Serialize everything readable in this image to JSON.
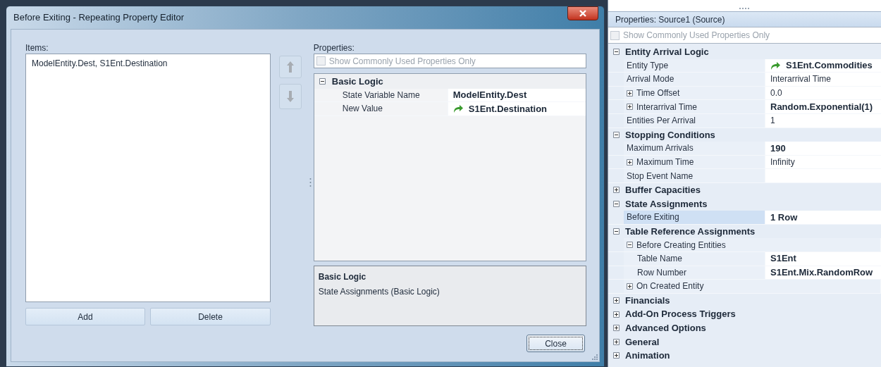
{
  "dialog": {
    "title": "Before Exiting - Repeating Property Editor",
    "items_label": "Items:",
    "items": [
      {
        "text": "ModelEntity.Dest, S1Ent.Destination",
        "selected": false
      }
    ],
    "add_button": "Add",
    "delete_button": "Delete",
    "properties_label": "Properties:",
    "show_common": {
      "label": "Show Commonly Used Properties Only",
      "checked": false
    },
    "categories": [
      {
        "label": "Basic Logic",
        "expanded": true,
        "children": [
          {
            "label": "State Variable Name",
            "value": "ModelEntity.Dest",
            "kind": "bold",
            "selected": false
          },
          {
            "label": "New Value",
            "value": "S1Ent.Destination",
            "kind": "reference",
            "selected": false
          }
        ]
      }
    ],
    "description": {
      "title": "Basic Logic",
      "text": "State Assignments (Basic Logic)"
    },
    "close_button": "Close"
  },
  "properties_panel": {
    "title": "Properties: Source1 (Source)",
    "show_common": {
      "label": "Show Commonly Used Properties Only",
      "checked": false
    },
    "categories": [
      {
        "label": "Entity Arrival Logic",
        "expanded": true,
        "children": [
          {
            "label": "Entity Type",
            "value": "S1Ent.Commodities",
            "kind": "reference",
            "selected": false
          },
          {
            "label": "Arrival Mode",
            "value": "Interarrival Time",
            "kind": "plain",
            "selected": false
          },
          {
            "label": "Time Offset",
            "value": "0.0",
            "kind": "plain",
            "selected": false,
            "expanded": false
          },
          {
            "label": "Interarrival Time",
            "value": "Random.Exponential(1)",
            "kind": "bold",
            "selected": false,
            "expanded": false
          },
          {
            "label": "Entities Per Arrival",
            "value": "1",
            "kind": "plain",
            "selected": false
          }
        ]
      },
      {
        "label": "Stopping Conditions",
        "expanded": true,
        "children": [
          {
            "label": "Maximum Arrivals",
            "value": "190",
            "kind": "bold",
            "selected": false
          },
          {
            "label": "Maximum Time",
            "value": "Infinity",
            "kind": "plain",
            "selected": false,
            "expanded": false
          },
          {
            "label": "Stop Event Name",
            "kind": "plain",
            "selected": false
          }
        ]
      },
      {
        "label": "Buffer Capacities",
        "expanded": false
      },
      {
        "label": "State Assignments",
        "expanded": true,
        "children": [
          {
            "label": "Before Exiting",
            "value": "1 Row",
            "kind": "bold",
            "selected": true
          }
        ]
      },
      {
        "label": "Table Reference Assignments",
        "expanded": true,
        "children": [
          {
            "label": "Before Creating Entities",
            "kind": "group",
            "selected": false,
            "expanded": true,
            "children": [
              {
                "label": "Table Name",
                "value": "S1Ent",
                "kind": "bold",
                "selected": false
              },
              {
                "label": "Row Number",
                "value": "S1Ent.Mix.RandomRow",
                "kind": "bold",
                "selected": false
              }
            ]
          },
          {
            "label": "On Created Entity",
            "kind": "group",
            "selected": false,
            "expanded": false
          }
        ]
      },
      {
        "label": "Financials",
        "expanded": false
      },
      {
        "label": "Add-On Process Triggers",
        "expanded": false
      },
      {
        "label": "Advanced Options",
        "expanded": false
      },
      {
        "label": "General",
        "expanded": false
      },
      {
        "label": "Animation",
        "expanded": false
      }
    ]
  }
}
